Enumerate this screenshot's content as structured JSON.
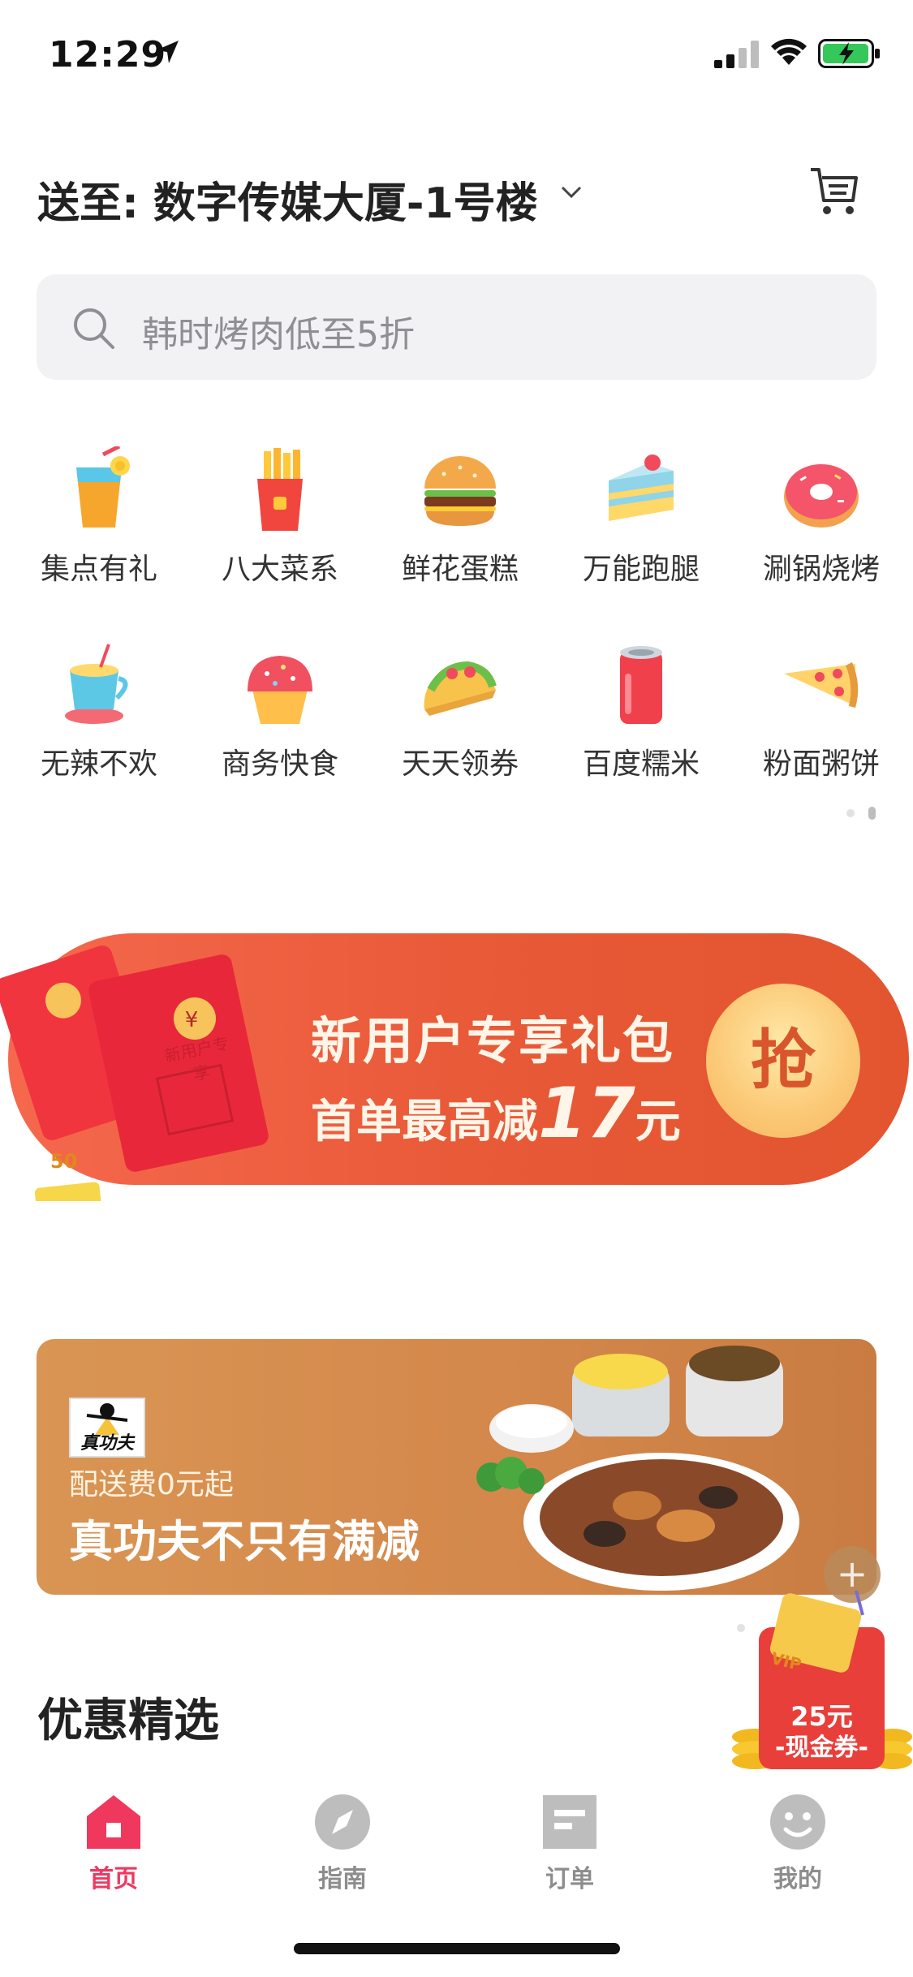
{
  "status_bar": {
    "time": "12:29"
  },
  "header": {
    "address": "送至: 数字传媒大厦-1号楼"
  },
  "search": {
    "placeholder": "韩时烤肉低至5折"
  },
  "categories": [
    {
      "label": "集点有礼",
      "icon": "juice-cup-icon"
    },
    {
      "label": "八大菜系",
      "icon": "french-fries-icon"
    },
    {
      "label": "鲜花蛋糕",
      "icon": "burger-icon"
    },
    {
      "label": "万能跑腿",
      "icon": "cake-slice-icon"
    },
    {
      "label": "涮锅烧烤",
      "icon": "donut-icon"
    },
    {
      "label": "无辣不欢",
      "icon": "coffee-cup-icon"
    },
    {
      "label": "商务快食",
      "icon": "cupcake-icon"
    },
    {
      "label": "天天领券",
      "icon": "taco-icon"
    },
    {
      "label": "百度糯米",
      "icon": "soda-can-icon"
    },
    {
      "label": "粉面粥饼",
      "icon": "pizza-slice-icon"
    }
  ],
  "promo_banner": {
    "line1": "新用户专享礼包",
    "line2_prefix": "首单最高减",
    "line2_amount": "17",
    "line2_suffix": "元",
    "grab_label": "抢",
    "envelope_text": "新用户专享",
    "coin_text": "50"
  },
  "store_banner": {
    "logo_text": "真功夫",
    "fee_text": "配送费0元起",
    "title": "真功夫不只有满减"
  },
  "section": {
    "title": "优惠精选"
  },
  "vip_float": {
    "amount": "25元",
    "label": "-现金券-",
    "badge": "VIP"
  },
  "tabs": [
    {
      "label": "首页",
      "active": true,
      "icon": "home-icon"
    },
    {
      "label": "指南",
      "active": false,
      "icon": "compass-icon"
    },
    {
      "label": "订单",
      "active": false,
      "icon": "order-icon"
    },
    {
      "label": "我的",
      "active": false,
      "icon": "profile-icon"
    }
  ],
  "colors": {
    "accent": "#f0385f",
    "promo": "#e85a38",
    "store": "#d4884b"
  }
}
